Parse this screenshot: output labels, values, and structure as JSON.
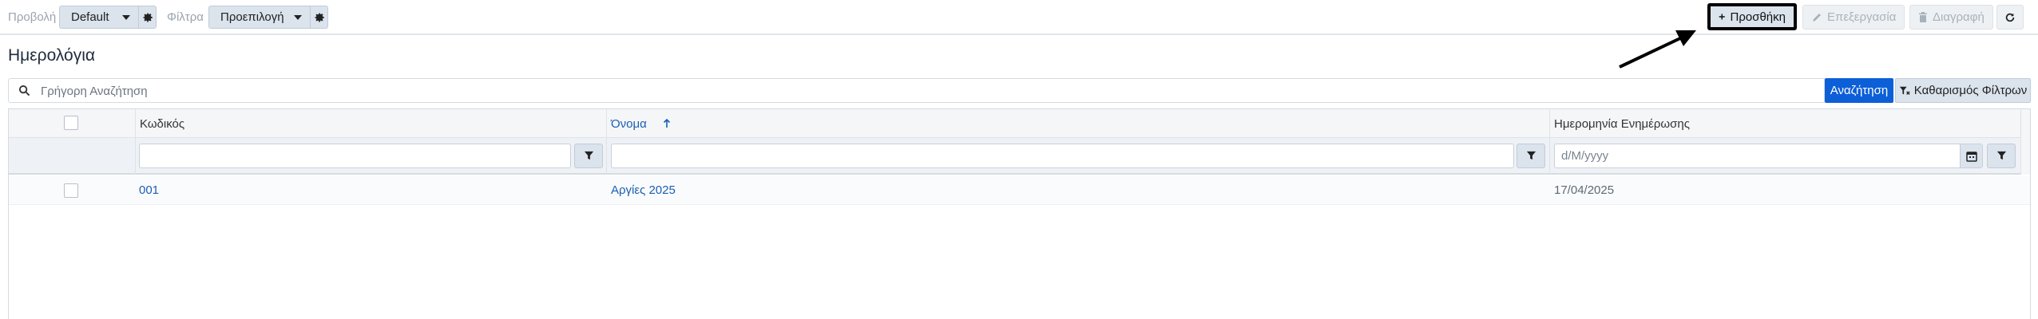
{
  "toolbar": {
    "view_label": "Προβολή",
    "view_value": "Default",
    "filter_label": "Φίλτρα",
    "filter_value": "Προεπιλογή",
    "add_label": "Προσθήκη",
    "edit_label": "Επεξεργασία",
    "delete_label": "Διαγραφή"
  },
  "page": {
    "title": "Ημερολόγια"
  },
  "search": {
    "placeholder": "Γρήγορη Αναζήτηση",
    "search_button": "Αναζήτηση",
    "clear_filters_button": "Καθαρισμός Φίλτρων"
  },
  "grid": {
    "columns": [
      {
        "label": "Κωδικός",
        "sorted": false
      },
      {
        "label": "Όνομα",
        "sorted": true,
        "sort_direction": "asc"
      },
      {
        "label": "Ημερομηνία Ενημέρωσης",
        "sorted": false
      }
    ],
    "date_filter_placeholder": "d/M/yyyy",
    "rows": [
      {
        "code": "001",
        "name": "Αργίες 2025",
        "updated": "17/04/2025"
      }
    ]
  },
  "colors": {
    "accent": "#0d5fd8",
    "link": "#1a5fb4",
    "button_bg": "#dbe3ec",
    "annotation_arrow": "#000000"
  },
  "icons": {
    "view_settings": "gear-icon",
    "filter_settings": "gear-icon",
    "add": "plus-icon",
    "edit": "pencil-icon",
    "delete": "trash-icon",
    "refresh": "refresh-icon",
    "search": "search-icon",
    "clear_filters": "filter-clear-icon",
    "column_filter": "funnel-icon",
    "date_picker": "calendar-icon",
    "sort": "arrow-up-icon"
  }
}
